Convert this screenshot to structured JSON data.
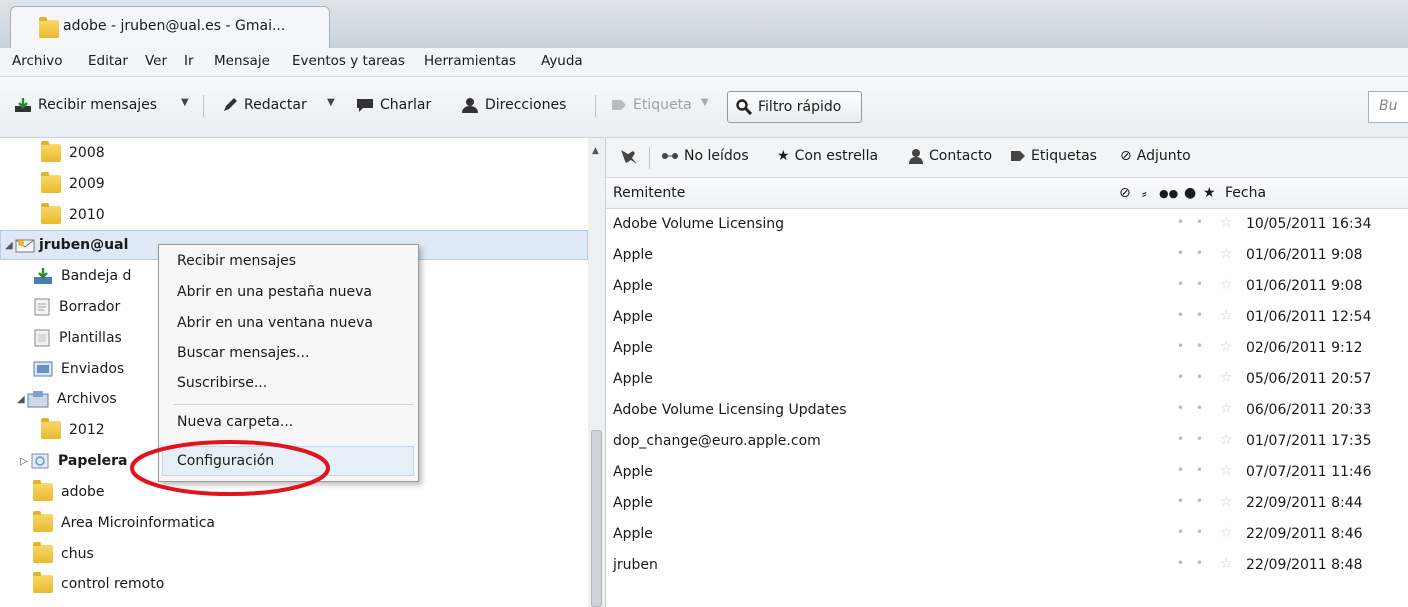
{
  "tab": {
    "title": "adobe - jruben@ual.es - Gmai..."
  },
  "menubar": [
    "Archivo",
    "Editar",
    "Ver",
    "Ir",
    "Mensaje",
    "Eventos y tareas",
    "Herramientas",
    "Ayuda"
  ],
  "toolbar": {
    "recibir": "Recibir mensajes",
    "redactar": "Redactar",
    "charlar": "Charlar",
    "direcciones": "Direcciones",
    "etiqueta": "Etiqueta",
    "filtro": "Filtro rápido",
    "search_placeholder": "Bu"
  },
  "folders": [
    "2008",
    "2009",
    "2010",
    "jruben@ual",
    "Bandeja d",
    "Borrador",
    "Plantillas",
    "Enviados",
    "Archivos",
    "2012",
    "Papelera",
    "adobe",
    "Area Microinformatica",
    "chus",
    "control remoto"
  ],
  "context_menu": {
    "items": [
      "Recibir mensajes",
      "Abrir en una pestaña nueva",
      "Abrir en una ventana nueva",
      "Buscar mensajes...",
      "Suscribirse...",
      "Nueva carpeta...",
      "Configuración"
    ]
  },
  "quickfilter": {
    "no_leidos": "No leídos",
    "con_estrella": "Con estrella",
    "contacto": "Contacto",
    "etiquetas": "Etiquetas",
    "adjunto": "Adjunto"
  },
  "columns": {
    "remitente": "Remitente",
    "fecha": "Fecha"
  },
  "messages": [
    {
      "from": "Adobe Volume Licensing",
      "date": "10/05/2011 16:34"
    },
    {
      "from": "Apple",
      "date": "01/06/2011 9:08"
    },
    {
      "from": "Apple",
      "date": "01/06/2011 9:08"
    },
    {
      "from": "Apple",
      "date": "01/06/2011 12:54"
    },
    {
      "from": "Apple",
      "date": "02/06/2011 9:12"
    },
    {
      "from": "Apple",
      "date": "05/06/2011 20:57"
    },
    {
      "from": "Adobe Volume Licensing Updates",
      "date": "06/06/2011 20:33"
    },
    {
      "from": "dop_change@euro.apple.com",
      "date": "01/07/2011 17:35"
    },
    {
      "from": "Apple",
      "date": "07/07/2011 11:46"
    },
    {
      "from": "Apple",
      "date": "22/09/2011 8:44"
    },
    {
      "from": "Apple",
      "date": "22/09/2011 8:46"
    },
    {
      "from": "jruben",
      "date": "22/09/2011 8:48"
    }
  ]
}
